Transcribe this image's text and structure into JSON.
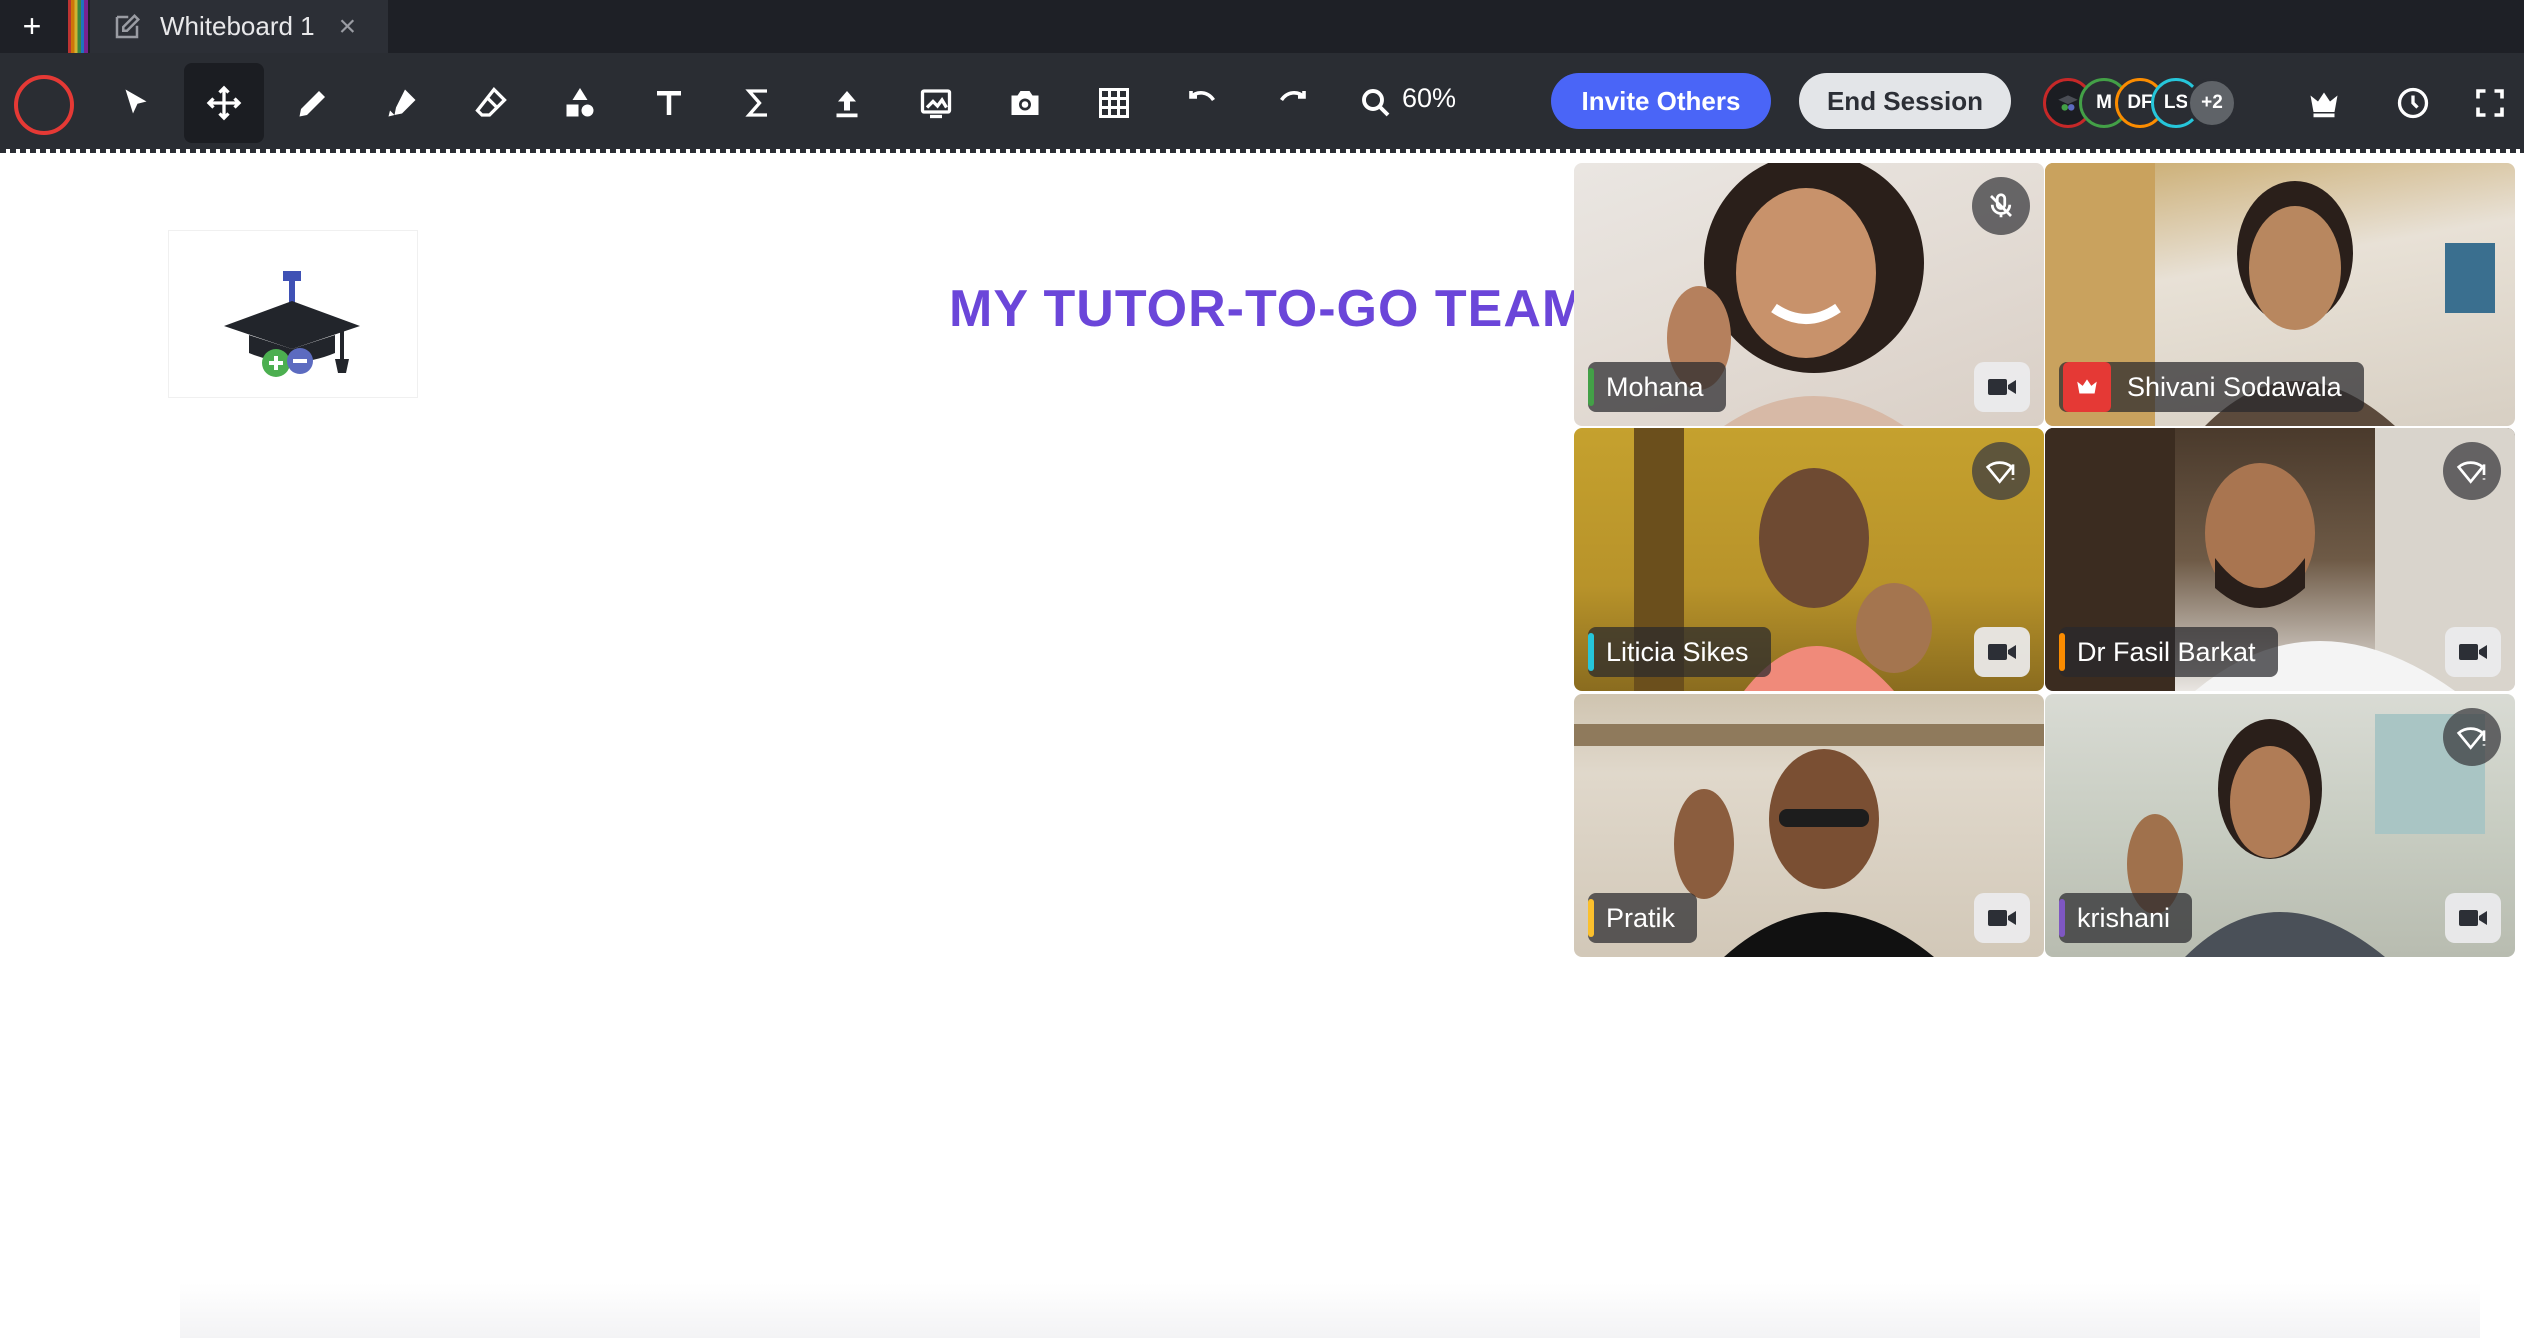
{
  "tabs": {
    "add_label": "+",
    "active_title": "Whiteboard 1",
    "close_label": "×"
  },
  "toolbar": {
    "tools": [
      "record",
      "select",
      "move",
      "pen",
      "highlighter",
      "eraser",
      "shapes",
      "text",
      "math",
      "upload",
      "image",
      "camera",
      "table",
      "undo",
      "redo",
      "zoom"
    ],
    "zoom_value": "60%",
    "invite_label": "Invite Others",
    "end_label": "End Session",
    "avatars": [
      {
        "initials": "",
        "color": "#c62828"
      },
      {
        "initials": "M",
        "color": "#43a047"
      },
      {
        "initials": "DF",
        "color": "#fb8c00"
      },
      {
        "initials": "LS",
        "color": "#26c6da"
      },
      {
        "initials": "+2",
        "color": "#5f6368"
      }
    ],
    "accent": "#4a65f7",
    "record_color": "#e53935"
  },
  "board": {
    "title": "MY TUTOR-TO-GO  TEAM",
    "title_color": "#6b46d9"
  },
  "participants": [
    {
      "name": "Mohana",
      "tag_color": "#43a047",
      "status_icon": "mic-off-icon",
      "host": false
    },
    {
      "name": "Shivani Sodawala",
      "tag_color": "#e53935",
      "status_icon": "",
      "host": true
    },
    {
      "name": "Liticia Sikes",
      "tag_color": "#26c6da",
      "status_icon": "weak-signal-icon",
      "host": false
    },
    {
      "name": "Dr Fasil Barkat",
      "tag_color": "#fb8c00",
      "status_icon": "weak-signal-icon",
      "host": false
    },
    {
      "name": "Pratik",
      "tag_color": "#fbc02d",
      "status_icon": "",
      "host": false
    },
    {
      "name": "krishani",
      "tag_color": "#7e57c2",
      "status_icon": "weak-signal-icon",
      "host": false
    }
  ]
}
